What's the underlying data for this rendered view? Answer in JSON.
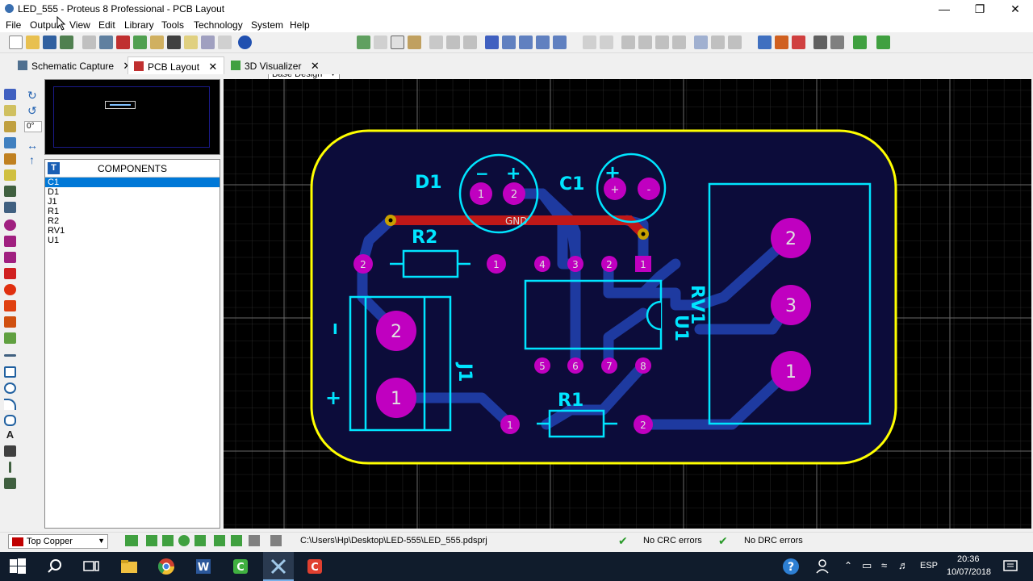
{
  "window": {
    "title": "LED_555 - Proteus 8 Professional - PCB Layout"
  },
  "menu": [
    "File",
    "Output",
    "View",
    "Edit",
    "Library",
    "Tools",
    "Technology",
    "System",
    "Help"
  ],
  "toolbar": {
    "design_select": "Base Design"
  },
  "tabs": [
    {
      "label": "Schematic Capture",
      "icon": "schematic-icon"
    },
    {
      "label": "PCB Layout",
      "icon": "pcb-icon"
    },
    {
      "label": "3D Visualizer",
      "icon": "3d-icon"
    }
  ],
  "rotation": {
    "angle": "0°"
  },
  "components_panel": {
    "title": "COMPONENTS",
    "badge": "T",
    "items": [
      "C1",
      "D1",
      "J1",
      "R1",
      "R2",
      "RV1",
      "U1"
    ],
    "selected": "C1"
  },
  "pcb": {
    "board_outline_color": "#ffff00",
    "copper_color": "#1e3aa0",
    "silk_color": "#00e5ff",
    "pad_color": "#c000c0",
    "labels": {
      "d1": "D1",
      "c1": "C1",
      "r2": "R2",
      "r1": "R1",
      "u1": "U1",
      "rv1": "RV1",
      "j1": "J1",
      "gnd": "GND"
    },
    "pad_numbers": {
      "d1": [
        "1",
        "2"
      ],
      "c1": [
        "+",
        "-"
      ],
      "r2": [
        "2",
        "1"
      ],
      "r1": [
        "1",
        "2"
      ],
      "u1_top": [
        "4",
        "3",
        "2",
        "1"
      ],
      "u1_bottom": [
        "5",
        "6",
        "7",
        "8"
      ],
      "rv1": [
        "2",
        "3",
        "1"
      ],
      "j1": [
        "2",
        "1"
      ]
    },
    "polarity": {
      "d1_minus": "−",
      "d1_plus": "+",
      "c1_plus": "+",
      "j1_plus": "+",
      "j1_minus": "I"
    }
  },
  "statusbar": {
    "layer": "Top Copper",
    "path": "C:\\Users\\Hp\\Desktop\\LED-555\\LED_555.pdsprj",
    "crc": "No CRC errors",
    "drc": "No DRC errors"
  },
  "taskbar": {
    "language": "ESP",
    "time": "20:36",
    "date": "10/07/2018"
  }
}
